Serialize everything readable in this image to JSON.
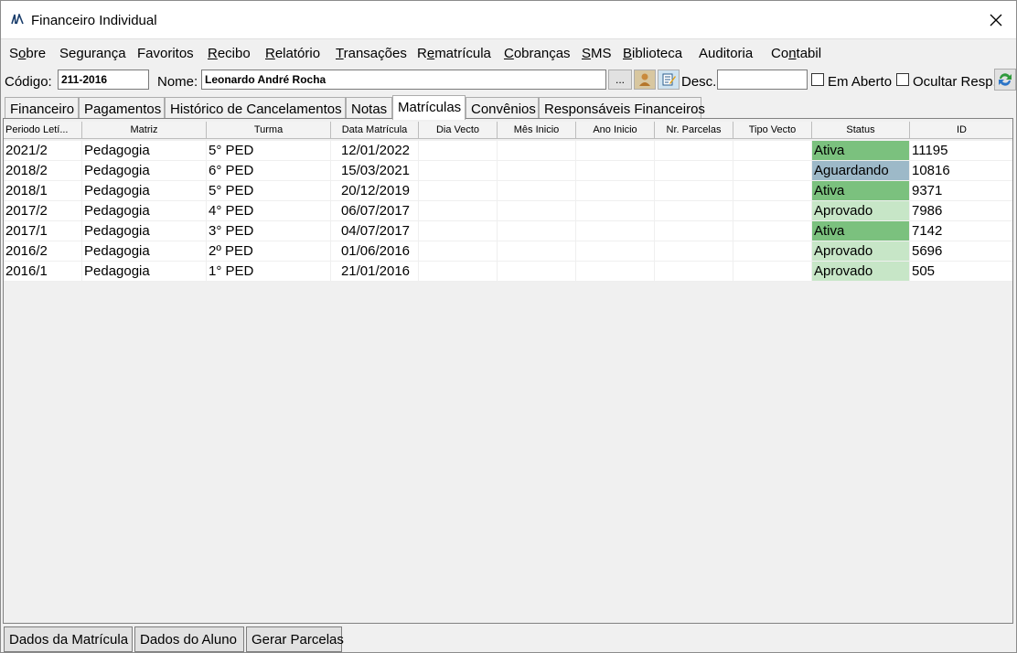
{
  "window": {
    "title": "Financeiro Individual"
  },
  "menu": [
    {
      "pre": "S",
      "u": "o",
      "post": "bre"
    },
    {
      "pre": "Segurança",
      "u": "",
      "post": ""
    },
    {
      "pre": "Favoritos",
      "u": "",
      "post": ""
    },
    {
      "pre": "",
      "u": "R",
      "post": "ecibo"
    },
    {
      "pre": "",
      "u": "R",
      "post": "elatório"
    },
    {
      "pre": "",
      "u": "T",
      "post": "ransações"
    },
    {
      "pre": "R",
      "u": "e",
      "post": "matrícula"
    },
    {
      "pre": "",
      "u": "C",
      "post": "obranças"
    },
    {
      "pre": "",
      "u": "S",
      "post": "MS"
    },
    {
      "pre": "",
      "u": "B",
      "post": "iblioteca"
    },
    {
      "pre": "Auditoria",
      "u": "",
      "post": ""
    },
    {
      "pre": "Co",
      "u": "n",
      "post": "tabil"
    }
  ],
  "toolbar": {
    "codigo_label": "Código:",
    "codigo_value": "211-2016",
    "nome_label": "Nome:",
    "nome_value": "Leonardo André Rocha",
    "dots_label": "...",
    "desc_label": "Desc.:",
    "desc_value": "",
    "em_aberto_label": "Em Aberto",
    "ocultar_label": "Ocultar Resp."
  },
  "tabs": [
    "Financeiro",
    "Pagamentos",
    "Histórico de Cancelamentos",
    "Notas",
    "Matrículas",
    "Convênios",
    "Responsáveis Financeiros"
  ],
  "active_tab": "Matrículas",
  "table": {
    "columns": [
      "Periodo Letí...",
      "Matriz",
      "Turma",
      "Data Matrícula",
      "Dia Vecto",
      "Mês Inicio",
      "Ano Inicio",
      "Nr. Parcelas",
      "Tipo Vecto",
      "Status",
      "ID"
    ],
    "rows": [
      {
        "periodo": "2021/2",
        "matriz": "Pedagogia",
        "turma": "5° PED",
        "data": "12/01/2022",
        "dia": "",
        "mes": "",
        "ano": "",
        "parcelas": "",
        "tipo": "",
        "status": "Ativa",
        "id": "11195"
      },
      {
        "periodo": "2018/2",
        "matriz": "Pedagogia",
        "turma": "6° PED",
        "data": "15/03/2021",
        "dia": "",
        "mes": "",
        "ano": "",
        "parcelas": "",
        "tipo": "",
        "status": "Aguardando",
        "id": "10816"
      },
      {
        "periodo": "2018/1",
        "matriz": "Pedagogia",
        "turma": "5° PED",
        "data": "20/12/2019",
        "dia": "",
        "mes": "",
        "ano": "",
        "parcelas": "",
        "tipo": "",
        "status": "Ativa",
        "id": "9371"
      },
      {
        "periodo": "2017/2",
        "matriz": "Pedagogia",
        "turma": "4° PED",
        "data": "06/07/2017",
        "dia": "",
        "mes": "",
        "ano": "",
        "parcelas": "",
        "tipo": "",
        "status": "Aprovado",
        "id": "7986"
      },
      {
        "periodo": "2017/1",
        "matriz": "Pedagogia",
        "turma": "3° PED",
        "data": "04/07/2017",
        "dia": "",
        "mes": "",
        "ano": "",
        "parcelas": "",
        "tipo": "",
        "status": "Ativa",
        "id": "7142"
      },
      {
        "periodo": "2016/2",
        "matriz": "Pedagogia",
        "turma": "2º PED",
        "data": "01/06/2016",
        "dia": "",
        "mes": "",
        "ano": "",
        "parcelas": "",
        "tipo": "",
        "status": "Aprovado",
        "id": "5696"
      },
      {
        "periodo": "2016/1",
        "matriz": "Pedagogia",
        "turma": "1° PED",
        "data": "21/01/2016",
        "dia": "",
        "mes": "",
        "ano": "",
        "parcelas": "",
        "tipo": "",
        "status": "Aprovado",
        "id": "505"
      }
    ]
  },
  "status_colors": {
    "Ativa": "#7bc17e",
    "Aguardando": "#9db9c8",
    "Aprovado": "#c7e6c7"
  },
  "bottom_buttons": [
    "Dados da Matrícula",
    "Dados do Aluno",
    "Gerar Parcelas"
  ]
}
